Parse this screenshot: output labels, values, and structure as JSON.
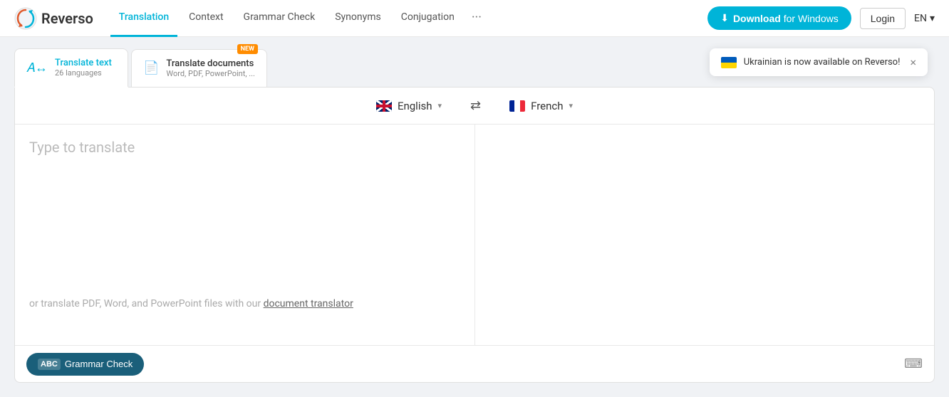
{
  "header": {
    "logo_text": "Reverso",
    "nav": [
      {
        "label": "Translation",
        "active": true
      },
      {
        "label": "Context",
        "active": false
      },
      {
        "label": "Grammar Check",
        "active": false
      },
      {
        "label": "Synonyms",
        "active": false
      },
      {
        "label": "Conjugation",
        "active": false
      },
      {
        "label": "···",
        "active": false
      }
    ],
    "download_btn": "Download",
    "download_suffix": "for Windows",
    "login": "Login",
    "lang_selector": "EN"
  },
  "tabs": [
    {
      "id": "translate-text",
      "title": "Translate text",
      "subtitle": "26 languages",
      "active": true,
      "badge": null
    },
    {
      "id": "translate-docs",
      "title": "Translate documents",
      "subtitle": "Word, PDF, PowerPoint, ...",
      "active": false,
      "badge": "NEW"
    }
  ],
  "notification": {
    "text": "Ukrainian is now available on Reverso!",
    "close_label": "×"
  },
  "translator": {
    "source_lang": "English",
    "target_lang": "French",
    "placeholder": "Type to translate",
    "helper_text": "or translate PDF, Word, and PowerPoint files with our",
    "helper_link": "document translator",
    "grammar_check_label": "Grammar Check",
    "grammar_abc": "ABC"
  }
}
